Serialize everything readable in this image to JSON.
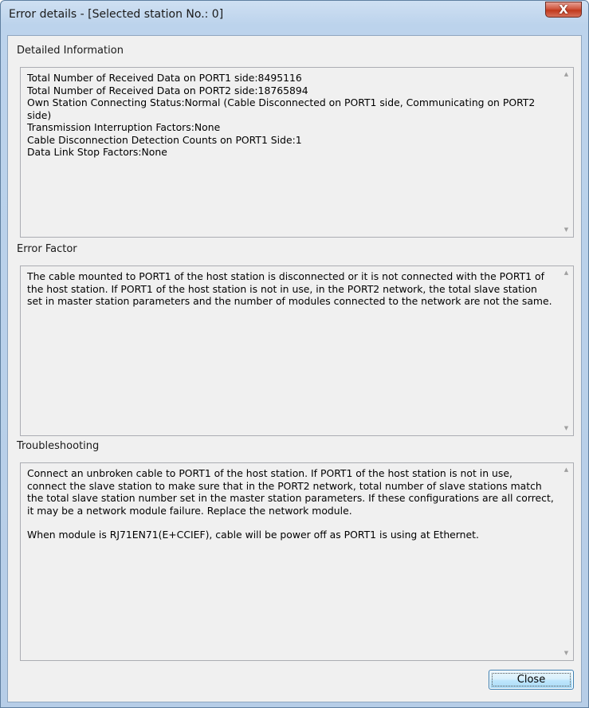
{
  "window": {
    "title": "Error details - [Selected station No.: 0]",
    "close_glyph": "X"
  },
  "sections": {
    "detailed_information": {
      "label": "Detailed Information",
      "lines": [
        "Total Number of Received Data on PORT1 side:8495116",
        "Total Number of Received Data on PORT2 side:18765894",
        "Own Station Connecting Status:Normal (Cable Disconnected on PORT1 side, Communicating on PORT2 side)",
        "Transmission Interruption Factors:None",
        "Cable Disconnection Detection Counts on PORT1 Side:1",
        "Data Link Stop Factors:None"
      ]
    },
    "error_factor": {
      "label": "Error Factor",
      "text": "The cable mounted to PORT1 of the host station is disconnected or it is not connected with the PORT1 of the host station. If PORT1 of the host station is not in use, in the PORT2 network, the total slave station set in master station parameters and the number of modules connected to the network are not the same."
    },
    "troubleshooting": {
      "label": "Troubleshooting",
      "paragraph1": "Connect an unbroken cable to PORT1 of the host station. If PORT1 of the host station is not in use, connect the slave station to make sure that in the PORT2 network, total number of slave stations match the total slave station number set in the master station parameters. If these configurations are all correct, it may be a network module failure. Replace the network module.",
      "paragraph2": "When module is RJ71EN71(E+CCIEF), cable will be power off as PORT1 is using at Ethernet."
    }
  },
  "buttons": {
    "close_label": "Close"
  },
  "icons": {
    "scroll_up": "scroll-up-arrow-icon",
    "scroll_down": "scroll-down-arrow-icon",
    "window_close": "close-icon"
  }
}
